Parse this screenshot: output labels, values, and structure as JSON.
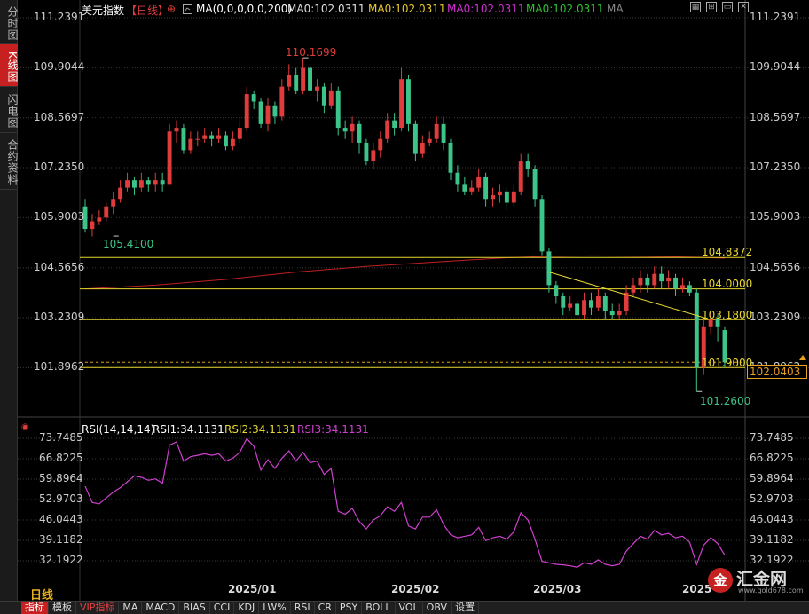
{
  "rail": {
    "tabs": [
      {
        "label": "分时图",
        "active": false
      },
      {
        "label": "K线图",
        "active": true
      },
      {
        "label": "闪电图",
        "active": false
      },
      {
        "label": "合约资料",
        "active": false
      }
    ]
  },
  "header": {
    "symbol": "美元指数",
    "period_tag": "【日线】",
    "add_icon": "add-circle-icon",
    "ma_params": "MA(0,0,0,0,0,200)",
    "ma_items": [
      {
        "label": "MA0:102.0311",
        "color": "#e0e0e0"
      },
      {
        "label": "MA0:102.0311",
        "color": "#e8c830"
      },
      {
        "label": "MA0:102.0311",
        "color": "#d030d0"
      },
      {
        "label": "MA0:102.0311",
        "color": "#30c030"
      },
      {
        "label": "MA",
        "color": "#888888"
      }
    ],
    "toolbar_icons": [
      "grid-icon",
      "chart-config-icon",
      "window-icon",
      "close-icon"
    ]
  },
  "price_axis": [
    "111.2391",
    "109.9044",
    "108.5697",
    "107.2350",
    "105.9003",
    "104.5656",
    "103.2309",
    "101.8962"
  ],
  "current_price": "102.0403",
  "rsi_panel": {
    "title": "RSI(14,14,14)",
    "rsi1": "RSI1:34.1131",
    "rsi2": "RSI2:34.1131",
    "rsi3": "RSI3:34.1131",
    "axis": [
      "73.7485",
      "66.8225",
      "59.8964",
      "52.9703",
      "46.0443",
      "39.1182",
      "32.1922"
    ]
  },
  "date_axis": [
    "2025/01",
    "2025/02",
    "2025/03",
    "2025"
  ],
  "period_label": "日线",
  "bottom_bar": [
    {
      "label": "指标",
      "sel": true,
      "vip": false
    },
    {
      "label": "模板",
      "sel": false,
      "vip": false
    },
    {
      "label": "VIP指标",
      "sel": false,
      "vip": true
    },
    {
      "label": "MA",
      "sel": false,
      "vip": false
    },
    {
      "label": "MACD",
      "sel": false,
      "vip": false
    },
    {
      "label": "BIAS",
      "sel": false,
      "vip": false
    },
    {
      "label": "CCI",
      "sel": false,
      "vip": false
    },
    {
      "label": "KDJ",
      "sel": false,
      "vip": false
    },
    {
      "label": "LW%",
      "sel": false,
      "vip": false
    },
    {
      "label": "RSI",
      "sel": false,
      "vip": false
    },
    {
      "label": "CR",
      "sel": false,
      "vip": false
    },
    {
      "label": "PSY",
      "sel": false,
      "vip": false
    },
    {
      "label": "BOLL",
      "sel": false,
      "vip": false
    },
    {
      "label": "VOL",
      "sel": false,
      "vip": false
    },
    {
      "label": "OBV",
      "sel": false,
      "vip": false
    },
    {
      "label": "设置",
      "sel": false,
      "vip": false
    }
  ],
  "watermark": {
    "text": "汇金网",
    "url": "www.gold678.com",
    "logo": "金"
  },
  "colors": {
    "up": "#e03c3c",
    "down": "#3cc48a",
    "level": "#e8d830",
    "ma200": "#c02020",
    "rsi": "#d040d0",
    "grid": "#3a3a3a"
  },
  "chart_data": {
    "type": "candlestick",
    "title": "美元指数 日线",
    "ylim": [
      101.2,
      111.6
    ],
    "annotations": {
      "high": "110.1699",
      "low_left": "105.4100",
      "low_right": "101.2600"
    },
    "levels": [
      {
        "label": "104.8372",
        "value": 104.8372
      },
      {
        "label": "104.0000",
        "value": 104.0
      },
      {
        "label": "103.1800",
        "value": 103.18
      },
      {
        "label": "101.9000",
        "value": 101.9
      }
    ],
    "candles": [
      [
        106.2,
        105.6,
        106.4,
        105.5
      ],
      [
        105.6,
        105.8,
        106.0,
        105.4
      ],
      [
        105.8,
        105.9,
        106.1,
        105.7
      ],
      [
        105.9,
        106.2,
        106.3,
        105.8
      ],
      [
        106.2,
        106.4,
        106.6,
        106.0
      ],
      [
        106.4,
        106.7,
        106.9,
        106.3
      ],
      [
        106.7,
        106.9,
        107.1,
        106.6
      ],
      [
        106.9,
        106.7,
        107.0,
        106.5
      ],
      [
        106.7,
        106.9,
        107.1,
        106.6
      ],
      [
        106.9,
        106.8,
        107.0,
        106.6
      ],
      [
        106.8,
        106.9,
        107.1,
        106.6
      ],
      [
        106.9,
        106.8,
        107.1,
        106.6
      ],
      [
        106.8,
        108.2,
        108.4,
        106.8
      ],
      [
        108.2,
        108.3,
        108.5,
        107.9
      ],
      [
        108.3,
        107.7,
        108.4,
        107.6
      ],
      [
        107.7,
        108.0,
        108.2,
        107.6
      ],
      [
        108.0,
        108.0,
        108.2,
        107.8
      ],
      [
        108.0,
        108.1,
        108.3,
        107.9
      ],
      [
        108.1,
        108.0,
        108.2,
        107.8
      ],
      [
        108.0,
        108.1,
        108.3,
        107.9
      ],
      [
        108.1,
        107.8,
        108.2,
        107.7
      ],
      [
        107.8,
        108.0,
        108.2,
        107.7
      ],
      [
        108.0,
        108.3,
        108.5,
        107.9
      ],
      [
        108.3,
        109.2,
        109.4,
        108.2
      ],
      [
        109.2,
        109.0,
        109.3,
        108.8
      ],
      [
        109.0,
        108.4,
        109.1,
        108.3
      ],
      [
        108.4,
        108.9,
        109.1,
        108.2
      ],
      [
        108.9,
        108.6,
        109.0,
        108.4
      ],
      [
        108.6,
        109.4,
        109.6,
        108.5
      ],
      [
        109.4,
        109.7,
        110.0,
        109.3
      ],
      [
        109.7,
        109.3,
        109.9,
        109.2
      ],
      [
        109.3,
        109.9,
        110.17,
        109.2
      ],
      [
        109.9,
        109.3,
        110.0,
        109.1
      ],
      [
        109.3,
        109.4,
        109.6,
        109.0
      ],
      [
        109.4,
        108.9,
        109.5,
        108.7
      ],
      [
        108.9,
        109.3,
        109.5,
        108.8
      ],
      [
        109.3,
        108.3,
        109.4,
        108.1
      ],
      [
        108.3,
        108.2,
        108.5,
        108.0
      ],
      [
        108.2,
        108.4,
        108.6,
        107.9
      ],
      [
        108.4,
        107.9,
        108.5,
        107.6
      ],
      [
        107.9,
        107.4,
        108.0,
        107.3
      ],
      [
        107.4,
        107.7,
        107.9,
        107.2
      ],
      [
        107.7,
        108.0,
        108.2,
        107.5
      ],
      [
        108.0,
        108.5,
        108.7,
        107.9
      ],
      [
        108.5,
        108.3,
        108.7,
        108.1
      ],
      [
        108.3,
        109.6,
        109.9,
        108.2
      ],
      [
        109.6,
        108.4,
        109.7,
        108.2
      ],
      [
        108.4,
        107.6,
        108.5,
        107.4
      ],
      [
        107.6,
        107.9,
        108.1,
        107.5
      ],
      [
        107.9,
        108.0,
        108.2,
        107.8
      ],
      [
        108.0,
        108.4,
        108.6,
        107.9
      ],
      [
        108.4,
        107.9,
        108.6,
        107.7
      ],
      [
        107.9,
        107.1,
        108.0,
        106.9
      ],
      [
        107.1,
        106.8,
        107.3,
        106.6
      ],
      [
        106.8,
        106.6,
        107.0,
        106.5
      ],
      [
        106.6,
        106.7,
        106.9,
        106.5
      ],
      [
        106.7,
        107.0,
        107.2,
        106.6
      ],
      [
        107.0,
        106.4,
        107.1,
        106.2
      ],
      [
        106.4,
        106.5,
        106.7,
        106.2
      ],
      [
        106.5,
        106.6,
        106.8,
        106.3
      ],
      [
        106.6,
        106.3,
        106.7,
        106.1
      ],
      [
        106.3,
        106.6,
        106.8,
        106.2
      ],
      [
        106.6,
        107.4,
        107.6,
        106.5
      ],
      [
        107.4,
        107.2,
        107.6,
        107.0
      ],
      [
        107.2,
        106.4,
        107.3,
        106.2
      ],
      [
        106.4,
        105.0,
        106.5,
        104.9
      ],
      [
        105.0,
        104.1,
        105.1,
        103.9
      ],
      [
        104.1,
        103.8,
        104.2,
        103.6
      ],
      [
        103.8,
        103.5,
        103.9,
        103.3
      ],
      [
        103.5,
        103.6,
        103.8,
        103.4
      ],
      [
        103.6,
        103.3,
        103.7,
        103.2
      ],
      [
        103.3,
        103.7,
        103.9,
        103.2
      ],
      [
        103.7,
        103.5,
        103.9,
        103.3
      ],
      [
        103.5,
        103.8,
        104.0,
        103.4
      ],
      [
        103.8,
        103.4,
        103.9,
        103.2
      ],
      [
        103.4,
        103.3,
        103.6,
        103.2
      ],
      [
        103.3,
        103.4,
        103.6,
        103.2
      ],
      [
        103.4,
        103.9,
        104.1,
        103.3
      ],
      [
        103.9,
        104.1,
        104.3,
        103.8
      ],
      [
        104.1,
        104.3,
        104.5,
        103.9
      ],
      [
        104.3,
        104.1,
        104.4,
        103.9
      ],
      [
        104.1,
        104.4,
        104.6,
        104.0
      ],
      [
        104.4,
        104.2,
        104.6,
        104.0
      ],
      [
        104.2,
        104.3,
        104.5,
        104.0
      ],
      [
        104.3,
        104.0,
        104.4,
        103.8
      ],
      [
        104.0,
        104.1,
        104.3,
        103.9
      ],
      [
        104.1,
        103.9,
        104.2,
        103.8
      ],
      [
        103.9,
        101.9,
        104.0,
        101.26
      ],
      [
        101.9,
        103.0,
        103.2,
        101.7
      ],
      [
        103.0,
        103.2,
        103.4,
        102.8
      ],
      [
        103.2,
        103.0,
        103.3,
        102.6
      ],
      [
        102.9,
        102.04,
        103.0,
        101.9
      ]
    ],
    "ma200": [
      [
        0,
        104.0
      ],
      [
        10,
        104.1
      ],
      [
        20,
        104.25
      ],
      [
        30,
        104.45
      ],
      [
        40,
        104.6
      ],
      [
        50,
        104.72
      ],
      [
        60,
        104.83
      ],
      [
        66,
        104.87
      ],
      [
        72,
        104.88
      ],
      [
        80,
        104.87
      ],
      [
        88,
        104.84
      ],
      [
        91,
        104.82
      ]
    ],
    "trendline": [
      [
        66,
        104.45
      ],
      [
        89,
        103.18
      ]
    ],
    "rsi": {
      "ylim": [
        29.0,
        76.5
      ],
      "values": [
        57.5,
        52.0,
        51.5,
        53.5,
        55.5,
        57.0,
        59.0,
        61.0,
        60.5,
        59.5,
        60.0,
        58.5,
        71.5,
        72.5,
        66.0,
        67.5,
        68.0,
        68.5,
        68.0,
        68.5,
        66.0,
        67.0,
        69.0,
        73.7,
        71.0,
        63.0,
        66.5,
        63.5,
        67.0,
        69.5,
        66.0,
        69.0,
        65.5,
        66.0,
        61.5,
        63.5,
        49.0,
        48.0,
        50.0,
        45.5,
        43.0,
        46.0,
        47.5,
        50.5,
        49.0,
        52.0,
        44.0,
        43.0,
        47.0,
        47.0,
        49.5,
        44.5,
        41.0,
        40.0,
        40.5,
        41.0,
        43.5,
        39.0,
        40.0,
        40.5,
        39.5,
        42.0,
        48.5,
        46.0,
        39.5,
        32.0,
        31.5,
        31.0,
        30.8,
        30.5,
        30.0,
        31.5,
        31.0,
        32.5,
        31.0,
        30.5,
        31.0,
        35.5,
        38.0,
        40.5,
        39.5,
        42.5,
        41.0,
        41.5,
        40.0,
        40.5,
        38.5,
        31.0,
        37.5,
        40.0,
        38.0,
        34.1
      ]
    }
  }
}
